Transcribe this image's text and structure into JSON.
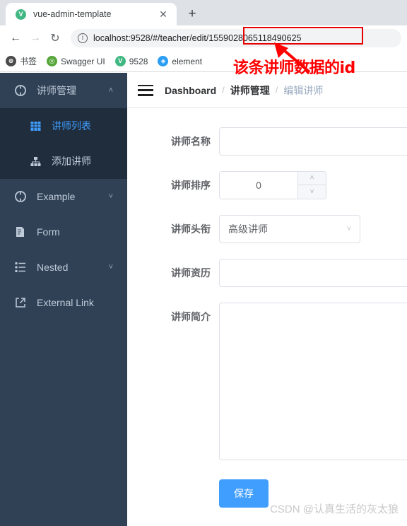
{
  "browser": {
    "tab": {
      "title": "vue-admin-template",
      "favicon_letter": "V",
      "close_glyph": "✕"
    },
    "new_tab_glyph": "+",
    "nav": {
      "back_glyph": "←",
      "forward_glyph": "→",
      "reload_glyph": "↻"
    },
    "omnibox": {
      "info_glyph": "i",
      "url_prefix": "localhost:9528/#/teacher/edit/",
      "url_id": "1559028065118490625"
    },
    "bookmarks": [
      {
        "label": "书签",
        "icon_color": "#4a4a4a",
        "icon_letter": "⊕"
      },
      {
        "label": "Swagger UI",
        "icon_color": "#55a63a",
        "icon_letter": "◎"
      },
      {
        "label": "9528",
        "icon_color": "#41b883",
        "icon_letter": "V"
      },
      {
        "label": "element",
        "icon_color": "#2a9df4",
        "icon_letter": "◈"
      }
    ]
  },
  "annotation": {
    "text": "该条讲师数据的id",
    "color": "#ff0000",
    "highlight_color": "#e60000"
  },
  "sidebar": {
    "bg_color": "#304156",
    "submenu_bg_color": "#1f2d3d",
    "active_color": "#409eff",
    "items": [
      {
        "label": "讲师管理",
        "icon": "component-circle-icon",
        "chevron": "˄",
        "expanded": true,
        "children": [
          {
            "label": "讲师列表",
            "icon": "table-grid-icon",
            "active": true
          },
          {
            "label": "添加讲师",
            "icon": "tree-hierarchy-icon",
            "active": false
          }
        ]
      },
      {
        "label": "Example",
        "icon": "component-circle-icon",
        "chevron": "˅",
        "expanded": false
      },
      {
        "label": "Form",
        "icon": "form-document-icon",
        "chevron": "",
        "expanded": false
      },
      {
        "label": "Nested",
        "icon": "list-nested-icon",
        "chevron": "˅",
        "expanded": false
      },
      {
        "label": "External Link",
        "icon": "external-link-icon",
        "chevron": "",
        "expanded": false
      }
    ]
  },
  "navbar": {
    "hamburger_icon": "hamburger-menu-icon",
    "breadcrumb": [
      {
        "label": "Dashboard",
        "current": true
      },
      {
        "label": "讲师管理",
        "current": true
      },
      {
        "label": "编辑讲师",
        "current": false
      }
    ],
    "separator": "/"
  },
  "form": {
    "fields": [
      {
        "label": "讲师名称",
        "type": "text",
        "value": "",
        "placeholder": ""
      },
      {
        "label": "讲师排序",
        "type": "number",
        "value": "0"
      },
      {
        "label": "讲师头衔",
        "type": "select",
        "value": "高级讲师",
        "arrow": "˅"
      },
      {
        "label": "讲师资历",
        "type": "text",
        "value": "",
        "placeholder": ""
      },
      {
        "label": "讲师简介",
        "type": "textarea",
        "value": "",
        "placeholder": ""
      }
    ],
    "number_up_glyph": "˄",
    "number_down_glyph": "˅",
    "save_label": "保存",
    "save_color": "#409eff"
  },
  "watermark": "CSDN @认真生活的灰太狼"
}
